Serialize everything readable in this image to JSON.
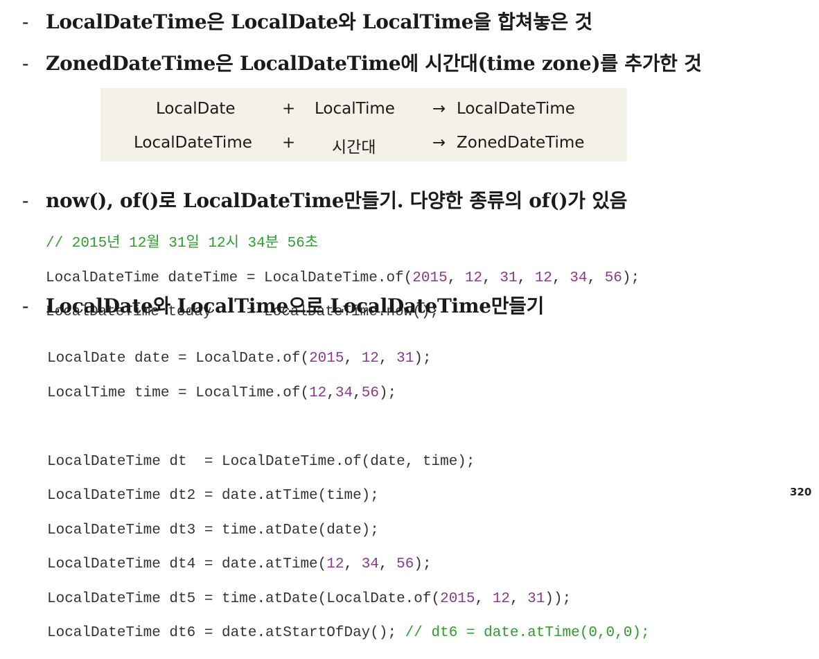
{
  "bullets": {
    "dash": "-",
    "b1": "LocalDateTime은 LocalDate와 LocalTime을 합쳐놓은 것",
    "b2": "ZonedDateTime은 LocalDateTime에 시간대(time zone)를 추가한 것",
    "b3": "now(), of()로 LocalDateTime만들기. 다양한 종류의 of()가 있음",
    "b4": "LocalDate와 LocalTime으로 LocalDateTime만들기"
  },
  "table": {
    "row1": {
      "left": "LocalDate",
      "op": "+",
      "mid": "LocalTime",
      "arrow": "→",
      "right": "LocalDateTime"
    },
    "row2": {
      "left": "LocalDateTime",
      "op": "+",
      "mid": "시간대",
      "arrow": "→",
      "right": "ZonedDateTime"
    }
  },
  "code1": {
    "comment": "// 2015년 12월 31일 12시 34분 56초",
    "l2a": "LocalDateTime dateTime = LocalDateTime.of(",
    "l2n1": "2015",
    "l2s1": ", ",
    "l2n2": "12",
    "l2s2": ", ",
    "l2n3": "31",
    "l2s3": ", ",
    "l2n4": "12",
    "l2s4": ", ",
    "l2n5": "34",
    "l2s5": ", ",
    "l2n6": "56",
    "l2b": ");",
    "l3": "LocalDateTime today    = LocalDateTime.now();"
  },
  "code2": {
    "l1a": "LocalDate date = LocalDate.of(",
    "l1n1": "2015",
    "l1s1": ", ",
    "l1n2": "12",
    "l1s2": ", ",
    "l1n3": "31",
    "l1b": ");",
    "l2a": "LocalTime time = LocalTime.of(",
    "l2n1": "12",
    "l2s1": ",",
    "l2n2": "34",
    "l2s2": ",",
    "l2n3": "56",
    "l2b": ");",
    "l4": "LocalDateTime dt  = LocalDateTime.of(date, time);",
    "l5": "LocalDateTime dt2 = date.atTime(time);",
    "l6": "LocalDateTime dt3 = time.atDate(date);",
    "l7a": "LocalDateTime dt4 = date.atTime(",
    "l7n1": "12",
    "l7s1": ", ",
    "l7n2": "34",
    "l7s2": ", ",
    "l7n3": "56",
    "l7b": ");",
    "l8a": "LocalDateTime dt5 = time.atDate(LocalDate.of(",
    "l8n1": "2015",
    "l8s1": ", ",
    "l8n2": "12",
    "l8s2": ", ",
    "l8n3": "31",
    "l8b": "));",
    "l9a": "LocalDateTime dt6 = date.atStartOfDay(); ",
    "l9c": "// dt6 = date.atTime(0,0,0);"
  },
  "page_number": "320"
}
